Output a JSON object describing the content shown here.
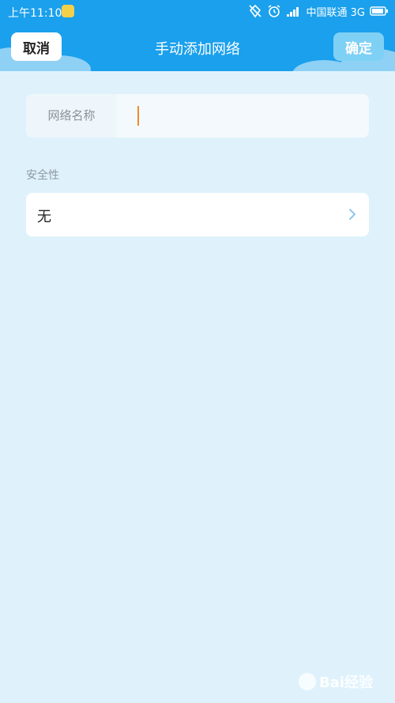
{
  "status_bar": {
    "time": "上午11:10",
    "carrier": "中国联通 3G"
  },
  "nav": {
    "cancel_label": "取消",
    "title": "手动添加网络",
    "confirm_label": "确定"
  },
  "form": {
    "network_name_label": "网络名称",
    "network_name_value": "",
    "security_section_label": "安全性",
    "security_value": "无"
  },
  "watermark": {
    "text": "Bai经验"
  },
  "colors": {
    "header": "#1aa0ec",
    "background": "#dff2fc",
    "caret": "#f08a2a",
    "confirm_button": "#7fd0f5"
  },
  "icons": {
    "app_badge": "notification-app-icon",
    "chevron": "chevron-right-icon"
  }
}
